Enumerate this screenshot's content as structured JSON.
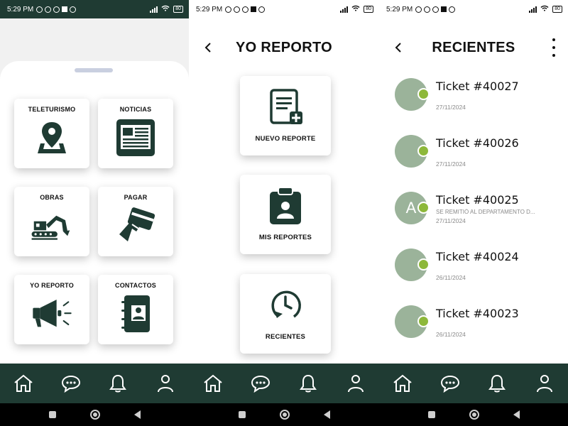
{
  "status": {
    "time": "5:29 PM",
    "battery": "80"
  },
  "colors": {
    "primary": "#1f3b33",
    "accent": "#8db83a",
    "avatar": "#9bb39a"
  },
  "nav": {
    "items": [
      "home-icon",
      "chat-icon",
      "bell-icon",
      "user-icon"
    ]
  },
  "screen1": {
    "tiles": [
      {
        "label": "TELETURISMO",
        "icon": "map-pin-icon"
      },
      {
        "label": "NOTICIAS",
        "icon": "newspaper-icon"
      },
      {
        "label": "OBRAS",
        "icon": "excavator-icon"
      },
      {
        "label": "PAGAR",
        "icon": "card-payment-icon"
      },
      {
        "label": "YO REPORTO",
        "icon": "megaphone-icon"
      },
      {
        "label": "CONTACTOS",
        "icon": "address-book-icon"
      }
    ]
  },
  "screen2": {
    "title": "YO REPORTO",
    "cards": [
      {
        "label": "NUEVO REPORTE",
        "icon": "new-report-icon"
      },
      {
        "label": "MIS REPORTES",
        "icon": "my-reports-icon"
      },
      {
        "label": "RECIENTES",
        "icon": "recent-history-icon"
      }
    ]
  },
  "screen3": {
    "title": "RECIENTES",
    "tickets": [
      {
        "title": "Ticket #40027",
        "subtitle": "",
        "date": "27/11/2024",
        "initial": ""
      },
      {
        "title": "Ticket #40026",
        "subtitle": "",
        "date": "27/11/2024",
        "initial": ""
      },
      {
        "title": "Ticket #40025",
        "subtitle": "SE REMITIÓ AL DEPARTAMENTO D...",
        "date": "27/11/2024",
        "initial": "A"
      },
      {
        "title": "Ticket #40024",
        "subtitle": "",
        "date": "26/11/2024",
        "initial": ""
      },
      {
        "title": "Ticket #40023",
        "subtitle": "",
        "date": "26/11/2024",
        "initial": ""
      }
    ]
  }
}
